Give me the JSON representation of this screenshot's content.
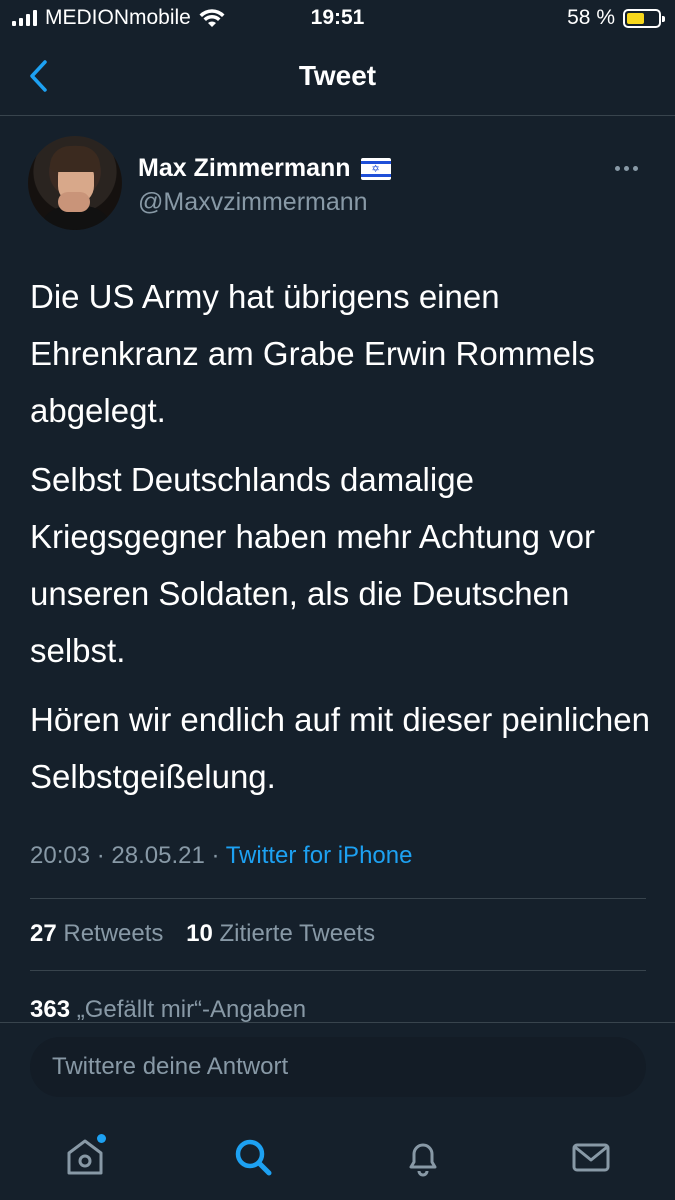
{
  "status_bar": {
    "carrier": "MEDIONmobile",
    "time": "19:51",
    "battery_percent": "58 %",
    "battery_level": 0.58,
    "battery_color": "#f7d71c"
  },
  "header": {
    "title": "Tweet",
    "back_icon": "chevron-left-icon"
  },
  "tweet": {
    "author": {
      "display_name": "Max Zimmermann",
      "flag_icon": "israel-flag-icon",
      "handle": "@Maxvzimmermann"
    },
    "paragraphs": [
      "Die US Army hat übrigens einen Ehrenkranz am Grabe Erwin Rommels abgelegt.",
      "Selbst Deutschlands damalige Kriegsgegner haben mehr Achtung vor unseren Soldaten, als die Deutschen selbst.",
      "Hören wir endlich auf mit dieser peinlichen Selbstgeißelung."
    ],
    "timestamp": "20:03 · 28.05.21 · ",
    "source": "Twitter for iPhone",
    "stats": {
      "retweets_count": "27",
      "retweets_label": "Retweets",
      "quotes_count": "10",
      "quotes_label": "Zitierte Tweets",
      "likes_count": "363",
      "likes_label": "„Gefällt mir“-Angaben"
    }
  },
  "reply": {
    "placeholder": "Twittere deine Antwort"
  },
  "tab_bar": {
    "items": [
      "home-icon",
      "search-icon",
      "bell-icon",
      "mail-icon"
    ],
    "active": "search-icon",
    "accent_color": "#1da1f2"
  },
  "colors": {
    "background": "#15202b",
    "secondary_text": "#8899a6",
    "divider": "#38444d",
    "link": "#1da1f2"
  }
}
